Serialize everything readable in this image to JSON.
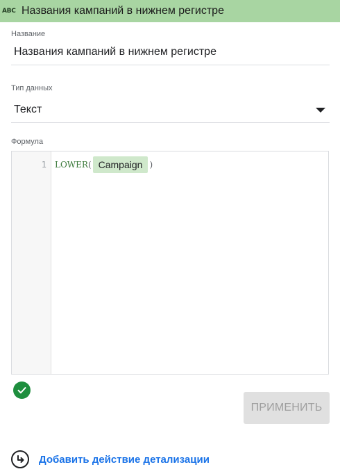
{
  "header": {
    "type_icon": "ABC",
    "title": "Названия кампаний в нижнем регистре"
  },
  "name_field": {
    "label": "Название",
    "value": "Названия кампаний в нижнем регистре"
  },
  "type_field": {
    "label": "Тип данных",
    "value": "Текст"
  },
  "formula": {
    "label": "Формула",
    "line_number": "1",
    "function": "LOWER",
    "open_paren": "(",
    "field_chip": "Campaign",
    "close_paren": ")"
  },
  "status": {
    "icon": "check-circle-icon",
    "color": "#1e8e3e"
  },
  "actions": {
    "apply_label": "ПРИМЕНИТЬ",
    "drill_label": "Добавить действие детализации"
  },
  "colors": {
    "header_bg": "#a8d5a2",
    "chip_bg": "#cfe8cb",
    "link": "#1a73e8"
  }
}
